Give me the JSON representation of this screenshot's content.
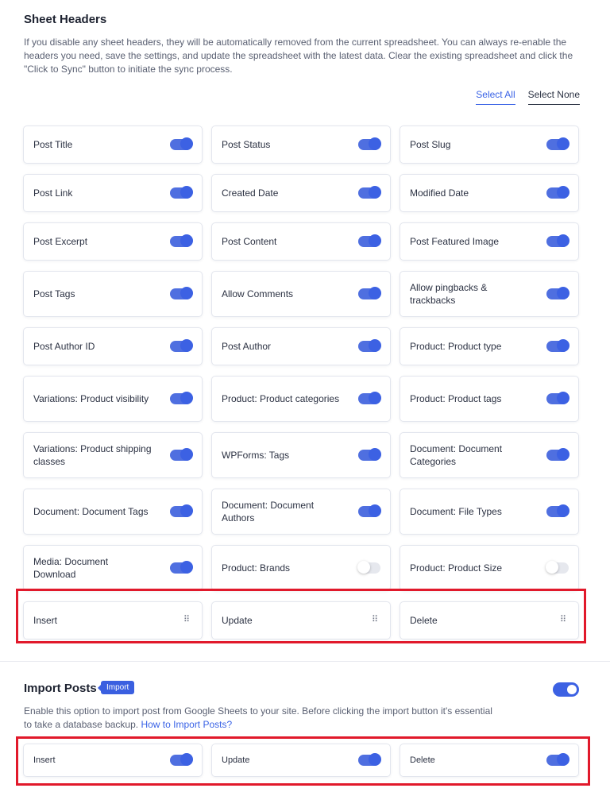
{
  "sheet_headers": {
    "title": "Sheet Headers",
    "description": "If you disable any sheet headers, they will be automatically removed from the current spreadsheet. You can always re-enable the headers you need, save the settings, and update the spreadsheet with the latest data. Clear the existing spreadsheet and click the \"Click to Sync\" button to initiate the sync process.",
    "select_all": "Select All",
    "select_none": "Select None",
    "items": [
      {
        "label": "Post Title",
        "enabled": true
      },
      {
        "label": "Post Status",
        "enabled": true
      },
      {
        "label": "Post Slug",
        "enabled": true
      },
      {
        "label": "Post Link",
        "enabled": true
      },
      {
        "label": "Created Date",
        "enabled": true
      },
      {
        "label": "Modified Date",
        "enabled": true
      },
      {
        "label": "Post Excerpt",
        "enabled": true
      },
      {
        "label": "Post Content",
        "enabled": true
      },
      {
        "label": "Post Featured Image",
        "enabled": true
      },
      {
        "label": "Post Tags",
        "enabled": true
      },
      {
        "label": "Allow Comments",
        "enabled": true
      },
      {
        "label": "Allow pingbacks & trackbacks",
        "enabled": true
      },
      {
        "label": "Post Author ID",
        "enabled": true
      },
      {
        "label": "Post Author",
        "enabled": true
      },
      {
        "label": "Product: Product type",
        "enabled": true
      },
      {
        "label": "Variations: Product visibility",
        "enabled": true
      },
      {
        "label": "Product: Product categories",
        "enabled": true
      },
      {
        "label": "Product: Product tags",
        "enabled": true
      },
      {
        "label": "Variations: Product shipping classes",
        "enabled": true
      },
      {
        "label": "WPForms: Tags",
        "enabled": true
      },
      {
        "label": "Document: Document Categories",
        "enabled": true
      },
      {
        "label": "Document: Document Tags",
        "enabled": true
      },
      {
        "label": "Document: Document Authors",
        "enabled": true
      },
      {
        "label": "Document: File Types",
        "enabled": true
      },
      {
        "label": "Media: Document Download",
        "enabled": true
      },
      {
        "label": "Product: Brands",
        "enabled": false
      },
      {
        "label": "Product: Product Size",
        "enabled": false
      }
    ],
    "actions": [
      "Insert",
      "Update",
      "Delete"
    ]
  },
  "import_posts": {
    "title": "Import Posts",
    "badge": "Import",
    "enabled": true,
    "description": "Enable this option to import post from Google Sheets to your site. Before clicking the import button it's essential to take a database backup.",
    "link": "How to Import Posts?",
    "items": [
      {
        "label": "Insert",
        "enabled": true
      },
      {
        "label": "Update",
        "enabled": true
      },
      {
        "label": "Delete",
        "enabled": true
      }
    ]
  },
  "colors": {
    "accent": "#3c61e3",
    "highlight": "#e1192b"
  }
}
